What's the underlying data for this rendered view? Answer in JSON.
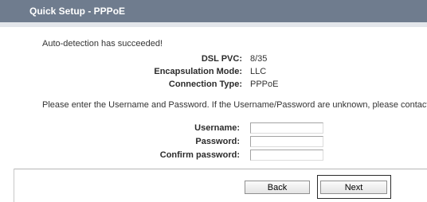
{
  "header": {
    "title": "Quick Setup - PPPoE"
  },
  "status_message": "Auto-detection has succeeded!",
  "details": [
    {
      "label": "DSL PVC:",
      "value": "8/35"
    },
    {
      "label": "Encapsulation Mode:",
      "value": "LLC"
    },
    {
      "label": "Connection Type:",
      "value": "PPPoE"
    }
  ],
  "instruction": "Please enter the Username and Password. If the Username/Password are unknown, please contact your ISP.",
  "form": {
    "username_label": "Username:",
    "username_value": "",
    "password_label": "Password:",
    "password_value": "",
    "confirm_label": "Confirm password:",
    "confirm_value": ""
  },
  "buttons": {
    "back": "Back",
    "next": "Next"
  },
  "colors": {
    "header_bg": "#6f7c8e",
    "header_text": "#ffffff"
  }
}
